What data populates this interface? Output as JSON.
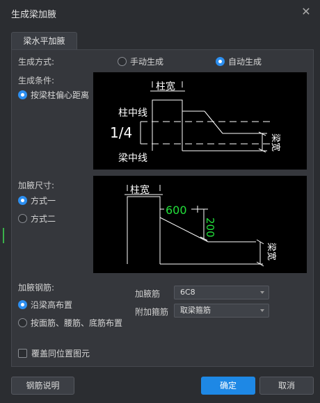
{
  "window": {
    "title": "生成梁加腋"
  },
  "tab": {
    "label": "梁水平加腋"
  },
  "generation_mode": {
    "label": "生成方式:",
    "options": [
      {
        "label": "手动生成",
        "selected": false
      },
      {
        "label": "自动生成",
        "selected": true
      }
    ]
  },
  "generation_condition": {
    "label": "生成条件:",
    "option": "按梁柱偏心距离",
    "diagram": {
      "col_width": "柱宽",
      "col_center": "柱中线",
      "ratio": "1/4",
      "beam_center": "梁中线",
      "beam_width": "梁宽"
    }
  },
  "haunch_size": {
    "label": "加腋尺寸:",
    "options": [
      {
        "label": "方式一",
        "selected": true
      },
      {
        "label": "方式二",
        "selected": false
      }
    ],
    "diagram": {
      "col_width": "柱宽",
      "length": "600",
      "height": "200",
      "beam_width": "梁宽"
    }
  },
  "haunch_rebar": {
    "label": "加腋钢筋:",
    "options": [
      {
        "label": "沿梁高布置",
        "selected": true
      },
      {
        "label": "按面筋、腰筋、底筋布置",
        "selected": false
      }
    ],
    "fields": [
      {
        "label": "加腋筋",
        "value": "6C8"
      },
      {
        "label": "附加箍筋",
        "value": "取梁箍筋"
      }
    ]
  },
  "overwrite": {
    "label": "覆盖同位置图元",
    "checked": false
  },
  "buttons": {
    "help": "钢筋说明",
    "ok": "确定",
    "cancel": "取消"
  },
  "colors": {
    "accent": "#1e88e5",
    "dimension_green": "#22e03a",
    "canvas_bg": "#000000"
  }
}
